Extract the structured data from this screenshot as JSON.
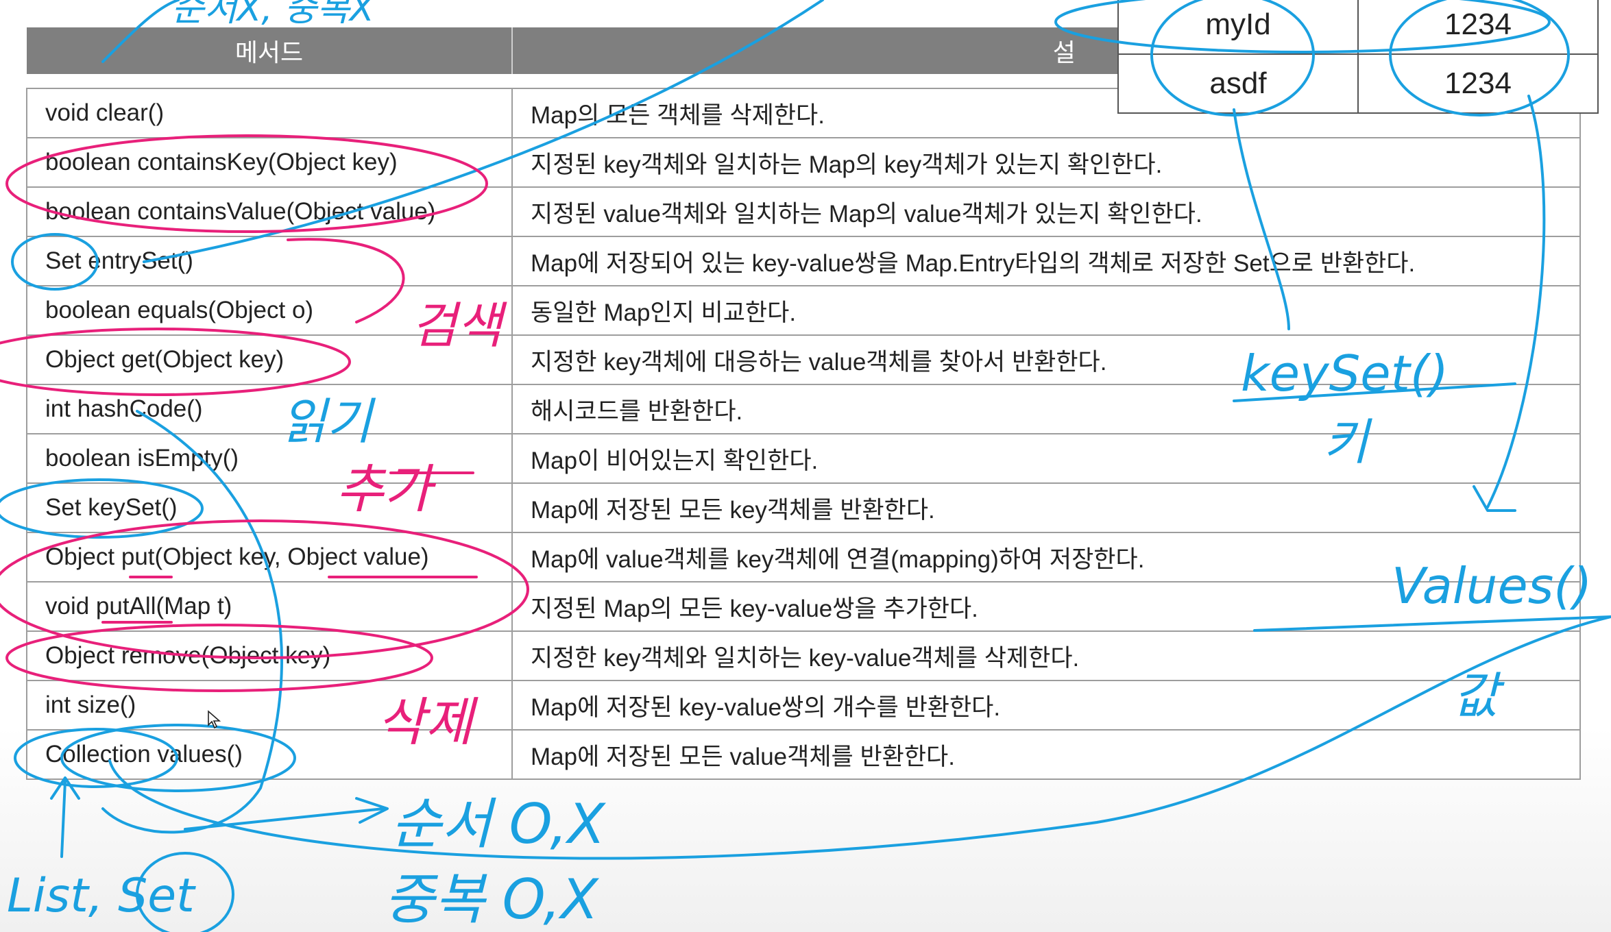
{
  "methods_table": {
    "header": {
      "method": "메서드",
      "description": "설 명"
    },
    "rows": [
      {
        "method": "void clear()",
        "description": "Map의 모든 객체를 삭제한다."
      },
      {
        "method": "boolean containsKey(Object key)",
        "description": "지정된 key객체와 일치하는 Map의 key객체가 있는지 확인한다."
      },
      {
        "method": "boolean containsValue(Object value)",
        "description": "지정된 value객체와 일치하는 Map의 value객체가 있는지 확인한다."
      },
      {
        "method": "Set entrySet()",
        "description": "Map에 저장되어 있는 key-value쌍을 Map.Entry타입의 객체로 저장한 Set으로 반환한다."
      },
      {
        "method": "boolean equals(Object o)",
        "description": "동일한 Map인지 비교한다."
      },
      {
        "method": "Object get(Object key)",
        "description": "지정한 key객체에 대응하는 value객체를 찾아서 반환한다."
      },
      {
        "method": "int hashCode()",
        "description": "해시코드를 반환한다."
      },
      {
        "method": "boolean isEmpty()",
        "description": "Map이 비어있는지 확인한다."
      },
      {
        "method": "Set keySet()",
        "description": "Map에 저장된 모든 key객체를 반환한다."
      },
      {
        "method": "Object put(Object key, Object value)",
        "description": "Map에 value객체를 key객체에 연결(mapping)하여 저장한다."
      },
      {
        "method": "void putAll(Map t)",
        "description": "지정된 Map의 모든 key-value쌍을 추가한다."
      },
      {
        "method": "Object remove(Object key)",
        "description": "지정한 key객체와 일치하는 key-value객체를 삭제한다."
      },
      {
        "method": "int size()",
        "description": "Map에 저장된 key-value쌍의 개수를 반환한다."
      },
      {
        "method": "Collection values()",
        "description": "Map에 저장된 모든 value객체를 반환한다."
      }
    ]
  },
  "key_value_table": {
    "rows": [
      {
        "key": "myId",
        "value": "1234"
      },
      {
        "key": "asdf",
        "value": "1234"
      }
    ]
  },
  "handwritten_notes": {
    "search": "검색",
    "read": "읽기",
    "add": "추가",
    "delete": "삭제",
    "keyset": "keySet()",
    "key": "키",
    "values": "Values()",
    "value": "값",
    "order": "순서 O,X",
    "duplicate": "중복 O,X",
    "list_set": "List, Set",
    "top_left": "순서X, 중복X"
  },
  "colors": {
    "header_bg": "#7f7f7f",
    "ink_blue": "#1aa0e0",
    "ink_pink": "#e8207a"
  }
}
